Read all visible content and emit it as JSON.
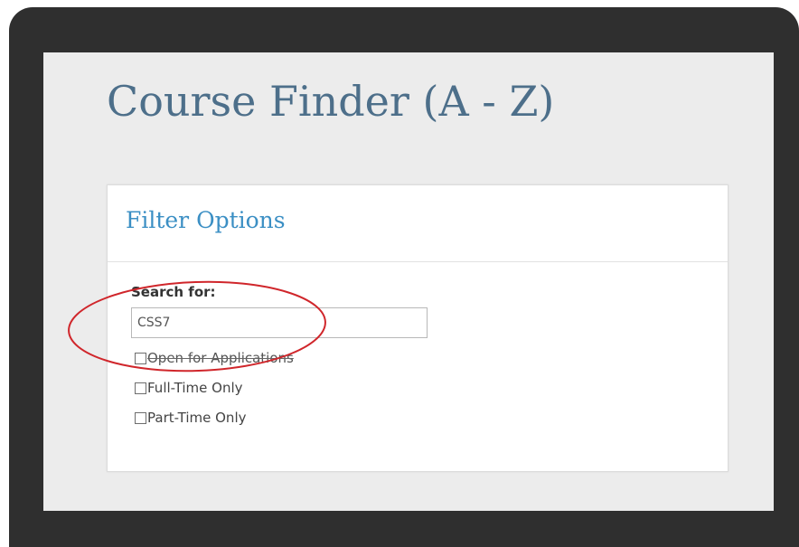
{
  "page": {
    "title": "Course Finder (A - Z)"
  },
  "filter_panel": {
    "title": "Filter Options",
    "search_label": "Search for:",
    "search_value": "CSS7",
    "options": [
      {
        "label": "Open for Applications",
        "checked": false
      },
      {
        "label": "Full-Time Only",
        "checked": false
      },
      {
        "label": "Part-Time Only",
        "checked": false
      }
    ]
  },
  "colors": {
    "frame": "#2f2f2f",
    "screen_background": "#ececec",
    "title": "#4d6f8a",
    "panel_title": "#3b8fc4",
    "annotation": "#d0262b"
  }
}
